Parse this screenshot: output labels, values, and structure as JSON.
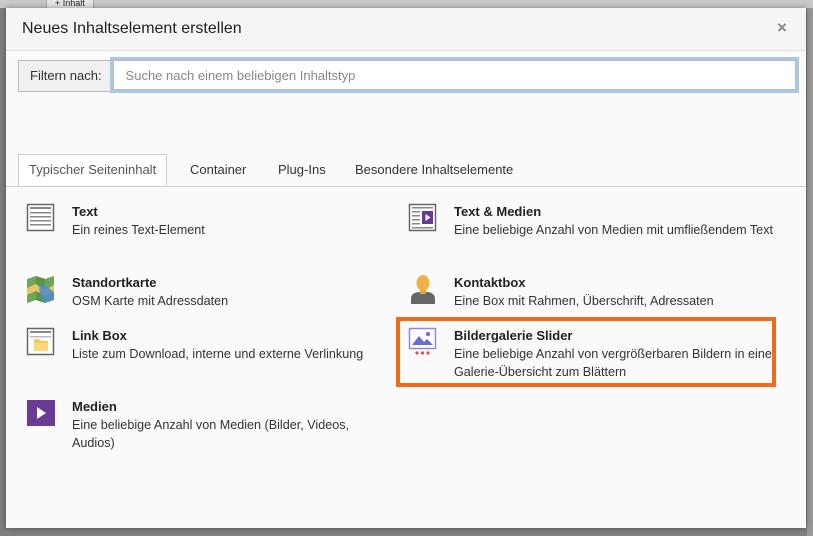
{
  "background": {
    "chip_label": "+ Inhalt"
  },
  "modal": {
    "title": "Neues Inhaltselement erstellen",
    "close_symbol": "×"
  },
  "filter": {
    "label": "Filtern nach:",
    "placeholder": "Suche nach einem beliebigen Inhaltstyp",
    "value": ""
  },
  "tabs": [
    {
      "label": "Typischer Seiteninhalt",
      "active": true
    },
    {
      "label": "Container",
      "active": false
    },
    {
      "label": "Plug-Ins",
      "active": false
    },
    {
      "label": "Besondere Inhaltselemente",
      "active": false
    }
  ],
  "items": [
    {
      "title": "Text",
      "desc": "Ein reines Text-Element",
      "icon": "text-icon"
    },
    {
      "title": "Text & Medien",
      "desc": "Eine beliebige Anzahl von Medien mit umfließendem Text",
      "icon": "text-media-icon"
    },
    {
      "title": "Standortkarte",
      "desc": "OSM Karte mit Adressdaten",
      "icon": "map-icon"
    },
    {
      "title": "Kontaktbox",
      "desc": "Eine Box mit Rahmen, Überschrift, Adressaten",
      "icon": "contact-person-icon"
    },
    {
      "title": "Link Box",
      "desc": "Liste zum Download, interne und externe Verlinkung",
      "icon": "link-box-icon"
    },
    {
      "title": "Bildergalerie Slider",
      "desc": "Eine beliebige Anzahl von vergrößerbaren Bildern in einer Galerie-Übersicht zum Blättern",
      "icon": "gallery-slider-icon"
    },
    {
      "title": "Medien",
      "desc": "Eine beliebige Anzahl von Medien (Bilder, Videos, Audios)",
      "icon": "media-play-icon"
    }
  ],
  "colors": {
    "highlight": "#ef6c1a",
    "media_purple": "#6b3a96",
    "focus_ring": "#a8c8e8"
  }
}
